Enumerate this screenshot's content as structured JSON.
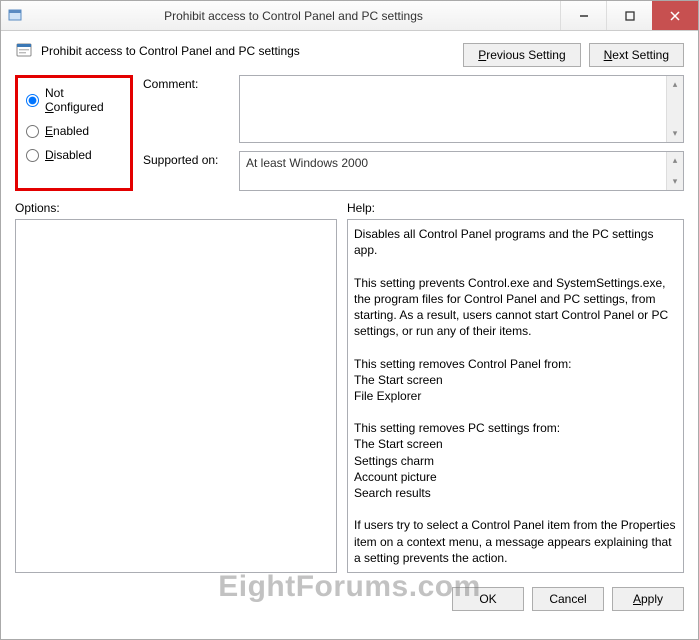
{
  "window": {
    "title": "Prohibit access to Control Panel and PC settings"
  },
  "header": {
    "heading": "Prohibit access to Control Panel and PC settings",
    "prev_label": "Previous Setting",
    "next_label": "Next Setting"
  },
  "radios": {
    "not_configured": "Not Configured",
    "enabled": "Enabled",
    "disabled": "Disabled",
    "selected": "not_configured"
  },
  "comment": {
    "label": "Comment:",
    "value": ""
  },
  "supported": {
    "label": "Supported on:",
    "value": "At least Windows 2000"
  },
  "sections": {
    "options_label": "Options:",
    "help_label": "Help:"
  },
  "help_text": "Disables all Control Panel programs and the PC settings app.\n\nThis setting prevents Control.exe and SystemSettings.exe, the program files for Control Panel and PC settings, from starting. As a result, users cannot start Control Panel or PC settings, or run any of their items.\n\nThis setting removes Control Panel from:\nThe Start screen\nFile Explorer\n\nThis setting removes PC settings from:\nThe Start screen\nSettings charm\nAccount picture\nSearch results\n\nIf users try to select a Control Panel item from the Properties item on a context menu, a message appears explaining that a setting prevents the action.",
  "footer": {
    "ok": "OK",
    "cancel": "Cancel",
    "apply": "Apply"
  },
  "watermark": "EightForums.com"
}
